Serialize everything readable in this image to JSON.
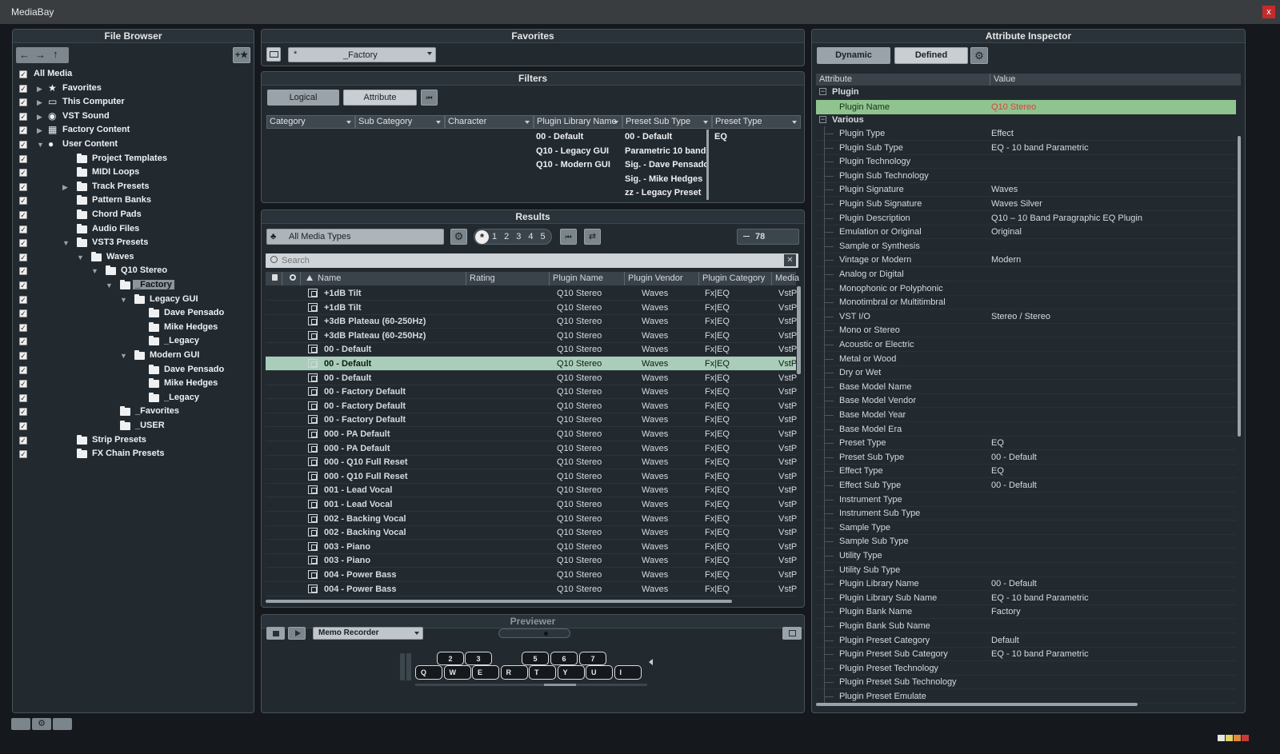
{
  "window": {
    "title": "MediaBay",
    "close": "x"
  },
  "file_browser": {
    "title": "File Browser",
    "fav_btn": "+★",
    "items": [
      {
        "label": "All Media",
        "level": 0
      },
      {
        "label": "Favorites",
        "level": 1
      },
      {
        "label": "This Computer",
        "level": 1
      },
      {
        "label": "VST Sound",
        "level": 1
      },
      {
        "label": "Factory Content",
        "level": 1
      },
      {
        "label": "User Content",
        "level": 1
      },
      {
        "label": "Project Templates",
        "level": 2
      },
      {
        "label": "MIDI Loops",
        "level": 2
      },
      {
        "label": "Track Presets",
        "level": 2
      },
      {
        "label": "Pattern Banks",
        "level": 2
      },
      {
        "label": "Chord Pads",
        "level": 2
      },
      {
        "label": "Audio Files",
        "level": 2
      },
      {
        "label": "VST3 Presets",
        "level": 2
      },
      {
        "label": "Waves",
        "level": 3
      },
      {
        "label": "Q10 Stereo",
        "level": 4
      },
      {
        "label": "_Factory",
        "level": 5
      },
      {
        "label": "Legacy GUI",
        "level": 6
      },
      {
        "label": "Dave Pensado",
        "level": 7
      },
      {
        "label": "Mike Hedges",
        "level": 7
      },
      {
        "label": "_Legacy",
        "level": 7
      },
      {
        "label": "Modern GUI",
        "level": 6
      },
      {
        "label": "Dave Pensado",
        "level": 7
      },
      {
        "label": "Mike Hedges",
        "level": 7
      },
      {
        "label": "_Legacy",
        "level": 7
      },
      {
        "label": "_Favorites",
        "level": 5
      },
      {
        "label": "_USER",
        "level": 5
      },
      {
        "label": "Strip Presets",
        "level": 2
      },
      {
        "label": "FX Chain Presets",
        "level": 2
      }
    ]
  },
  "favorites": {
    "title": "Favorites",
    "star": "*",
    "selected": "_Factory"
  },
  "filters": {
    "title": "Filters",
    "tab_logical": "Logical",
    "tab_attribute": "Attribute",
    "columns": [
      "Category",
      "Sub Category",
      "Character",
      "Plugin Library Name",
      "Preset Sub Type",
      "Preset Type"
    ],
    "plugin_library_name": [
      "00 - Default",
      "Q10 - Legacy GUI",
      "Q10 - Modern GUI"
    ],
    "preset_sub_type": [
      "00 - Default",
      "Parametric 10 band",
      "Sig. - Dave Pensado",
      "Sig. - Mike Hedges",
      "zz - Legacy Preset"
    ],
    "preset_type": [
      "EQ"
    ]
  },
  "results": {
    "title": "Results",
    "media_type": "All Media Types",
    "ratings": [
      "1",
      "2",
      "3",
      "4",
      "5"
    ],
    "count": "78",
    "search_placeholder": "Search",
    "columns": [
      "Name",
      "Rating",
      "Plugin Name",
      "Plugin Vendor",
      "Plugin Category",
      "Media"
    ],
    "rows": [
      [
        "+1dB Tilt",
        "Q10 Stereo",
        "Waves",
        "Fx|EQ",
        "VstP"
      ],
      [
        "+1dB Tilt",
        "Q10 Stereo",
        "Waves",
        "Fx|EQ",
        "VstP"
      ],
      [
        "+3dB Plateau  (60-250Hz)",
        "Q10 Stereo",
        "Waves",
        "Fx|EQ",
        "VstP"
      ],
      [
        "+3dB Plateau  (60-250Hz)",
        "Q10 Stereo",
        "Waves",
        "Fx|EQ",
        "VstP"
      ],
      [
        "00 - Default",
        "Q10 Stereo",
        "Waves",
        "Fx|EQ",
        "VstP"
      ],
      [
        "00 - Default",
        "Q10 Stereo",
        "Waves",
        "Fx|EQ",
        "VstP"
      ],
      [
        "00 - Default",
        "Q10 Stereo",
        "Waves",
        "Fx|EQ",
        "VstP"
      ],
      [
        "00 - Factory Default",
        "Q10 Stereo",
        "Waves",
        "Fx|EQ",
        "VstP"
      ],
      [
        "00 - Factory Default",
        "Q10 Stereo",
        "Waves",
        "Fx|EQ",
        "VstP"
      ],
      [
        "00 - Factory Default",
        "Q10 Stereo",
        "Waves",
        "Fx|EQ",
        "VstP"
      ],
      [
        "000 - PA Default",
        "Q10 Stereo",
        "Waves",
        "Fx|EQ",
        "VstP"
      ],
      [
        "000 - PA Default",
        "Q10 Stereo",
        "Waves",
        "Fx|EQ",
        "VstP"
      ],
      [
        "000 - Q10 Full Reset",
        "Q10 Stereo",
        "Waves",
        "Fx|EQ",
        "VstP"
      ],
      [
        "000 - Q10 Full Reset",
        "Q10 Stereo",
        "Waves",
        "Fx|EQ",
        "VstP"
      ],
      [
        "001 - Lead Vocal",
        "Q10 Stereo",
        "Waves",
        "Fx|EQ",
        "VstP"
      ],
      [
        "001 - Lead Vocal",
        "Q10 Stereo",
        "Waves",
        "Fx|EQ",
        "VstP"
      ],
      [
        "002 - Backing Vocal",
        "Q10 Stereo",
        "Waves",
        "Fx|EQ",
        "VstP"
      ],
      [
        "002 - Backing Vocal",
        "Q10 Stereo",
        "Waves",
        "Fx|EQ",
        "VstP"
      ],
      [
        "003 - Piano",
        "Q10 Stereo",
        "Waves",
        "Fx|EQ",
        "VstP"
      ],
      [
        "003 - Piano",
        "Q10 Stereo",
        "Waves",
        "Fx|EQ",
        "VstP"
      ],
      [
        "004 - Power Bass",
        "Q10 Stereo",
        "Waves",
        "Fx|EQ",
        "VstP"
      ],
      [
        "004 - Power Bass",
        "Q10 Stereo",
        "Waves",
        "Fx|EQ",
        "VstP"
      ]
    ],
    "selected_row": 5
  },
  "previewer": {
    "title": "Previewer",
    "mode": "Memo Recorder",
    "black_keys": [
      "2",
      "3",
      "5",
      "6",
      "7"
    ],
    "white_keys": [
      "Q",
      "W",
      "E",
      "R",
      "T",
      "Y",
      "U",
      "I"
    ]
  },
  "inspector": {
    "title": "Attribute Inspector",
    "tab_dynamic": "Dynamic",
    "tab_defined": "Defined",
    "col_attr": "Attribute",
    "col_value": "Value",
    "group_plugin": "Plugin",
    "group_various": "Various",
    "plugin_name_key": "Plugin Name",
    "plugin_name_value": "Q10 Stereo",
    "rows": [
      [
        "Plugin Type",
        "Effect"
      ],
      [
        "Plugin Sub Type",
        "EQ - 10 band Parametric"
      ],
      [
        "Plugin Technology",
        ""
      ],
      [
        "Plugin Sub Technology",
        ""
      ],
      [
        "Plugin Signature",
        "Waves"
      ],
      [
        "Plugin Sub Signature",
        "Waves Silver"
      ],
      [
        "Plugin Description",
        "Q10 – 10 Band Paragraphic EQ Plugin"
      ],
      [
        "Emulation or Original",
        "Original"
      ],
      [
        "Sample or Synthesis",
        ""
      ],
      [
        "Vintage or Modern",
        "Modern"
      ],
      [
        "Analog or Digital",
        ""
      ],
      [
        "Monophonic or Polyphonic",
        ""
      ],
      [
        "Monotimbral or Multitimbral",
        ""
      ],
      [
        "VST I/O",
        "Stereo / Stereo"
      ],
      [
        "Mono or Stereo",
        ""
      ],
      [
        "Acoustic or Electric",
        ""
      ],
      [
        "Metal or Wood",
        ""
      ],
      [
        "Dry or Wet",
        ""
      ],
      [
        "Base Model Name",
        ""
      ],
      [
        "Base Model Vendor",
        ""
      ],
      [
        "Base Model Year",
        ""
      ],
      [
        "Base Model Era",
        ""
      ],
      [
        "Preset Type",
        "EQ"
      ],
      [
        "Preset Sub Type",
        "00 - Default"
      ],
      [
        "Effect Type",
        "EQ"
      ],
      [
        "Effect Sub Type",
        "00 - Default"
      ],
      [
        "Instrument Type",
        ""
      ],
      [
        "Instrument Sub Type",
        ""
      ],
      [
        "Sample Type",
        ""
      ],
      [
        "Sample Sub Type",
        ""
      ],
      [
        "Utility Type",
        ""
      ],
      [
        "Utility Sub Type",
        ""
      ],
      [
        "Plugin Library Name",
        "00 - Default"
      ],
      [
        "Plugin Library Sub Name",
        "EQ - 10 band Parametric"
      ],
      [
        "Plugin Bank Name",
        "Factory"
      ],
      [
        "Plugin Bank Sub Name",
        ""
      ],
      [
        "Plugin Preset Category",
        "Default"
      ],
      [
        "Plugin Preset Sub Category",
        "EQ - 10 band Parametric"
      ],
      [
        "Plugin Preset Technology",
        ""
      ],
      [
        "Plugin Preset Sub Technology",
        ""
      ],
      [
        "Plugin Preset Emulate",
        ""
      ]
    ]
  },
  "colors": {
    "selection": "#aacdb9",
    "plugin_name_row": "#8fc48f",
    "plugin_name_value": "#d9443a"
  }
}
